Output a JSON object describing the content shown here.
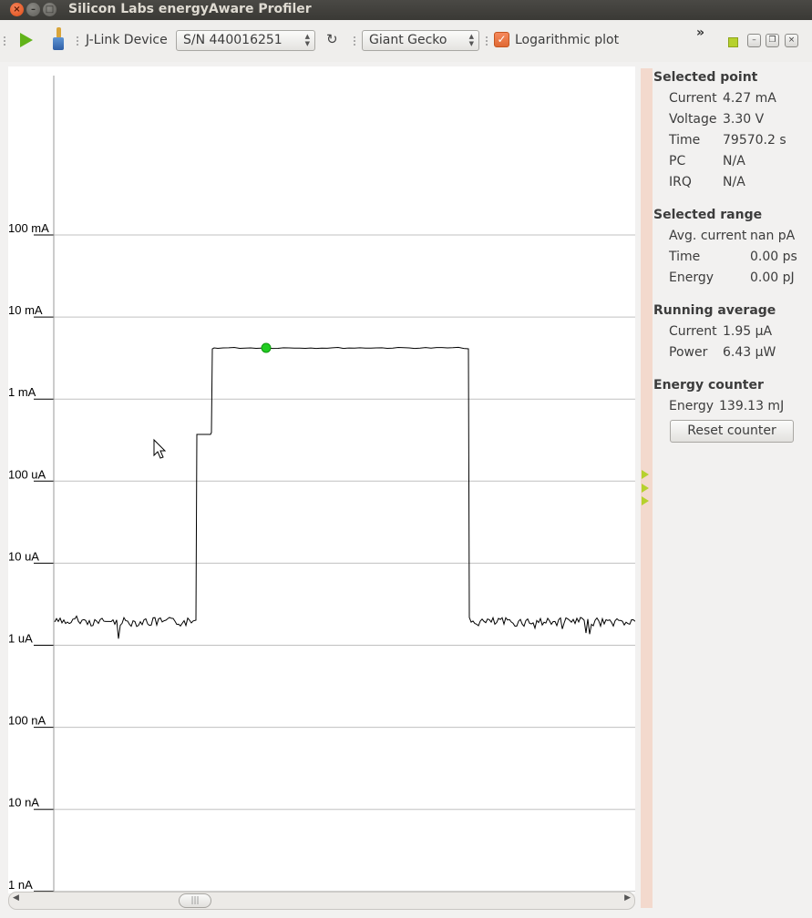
{
  "window": {
    "title": "Silicon Labs energyAware Profiler",
    "close_glyph": "×",
    "min_glyph": "–",
    "max_glyph": "□"
  },
  "toolbar": {
    "device_label": "J-Link Device",
    "device_serial": "S/N 440016251",
    "target_family": "Giant Gecko",
    "log_plot_label": "Logarithmic plot",
    "log_plot_checked": true,
    "refresh_glyph": "↻",
    "overflow_glyph": "»",
    "checkmark_glyph": "✓",
    "mdi_minimize_glyph": "–",
    "mdi_restore_glyph": "❐",
    "mdi_close_glyph": "×"
  },
  "plot": {
    "y_axis_labels": [
      "100 mA",
      "10 mA",
      "1 mA",
      "100 uA",
      "10 uA",
      "1 uA",
      "100 nA",
      "10 nA",
      "1 nA"
    ],
    "y_scale": "log",
    "selected_point_color": "#22cc22",
    "trace_color": "#000000",
    "grid_color": "#c0c0c0"
  },
  "scrollbar": {
    "left_arrow": "◀",
    "right_arrow": "▶",
    "thumb_glyph": "|||"
  },
  "panel": {
    "selected_point": {
      "title": "Selected point",
      "rows": [
        {
          "label": "Current",
          "value": "4.27 mA"
        },
        {
          "label": "Voltage",
          "value": "3.30 V"
        },
        {
          "label": "Time",
          "value": "79570.2 s"
        },
        {
          "label": "PC",
          "value": "N/A"
        },
        {
          "label": "IRQ",
          "value": "N/A"
        }
      ]
    },
    "selected_range": {
      "title": "Selected range",
      "rows": [
        {
          "label": "Avg. current",
          "value": "nan pA"
        },
        {
          "label": "Time",
          "value": "0.00 ps"
        },
        {
          "label": "Energy",
          "value": "0.00 pJ"
        }
      ]
    },
    "running_average": {
      "title": "Running average",
      "rows": [
        {
          "label": "Current",
          "value": "1.95 µA"
        },
        {
          "label": "Power",
          "value": "6.43 µW"
        }
      ]
    },
    "energy_counter": {
      "title": "Energy counter",
      "rows": [
        {
          "label": "Energy",
          "value": "139.13 mJ"
        }
      ],
      "reset_label": "Reset counter"
    }
  }
}
